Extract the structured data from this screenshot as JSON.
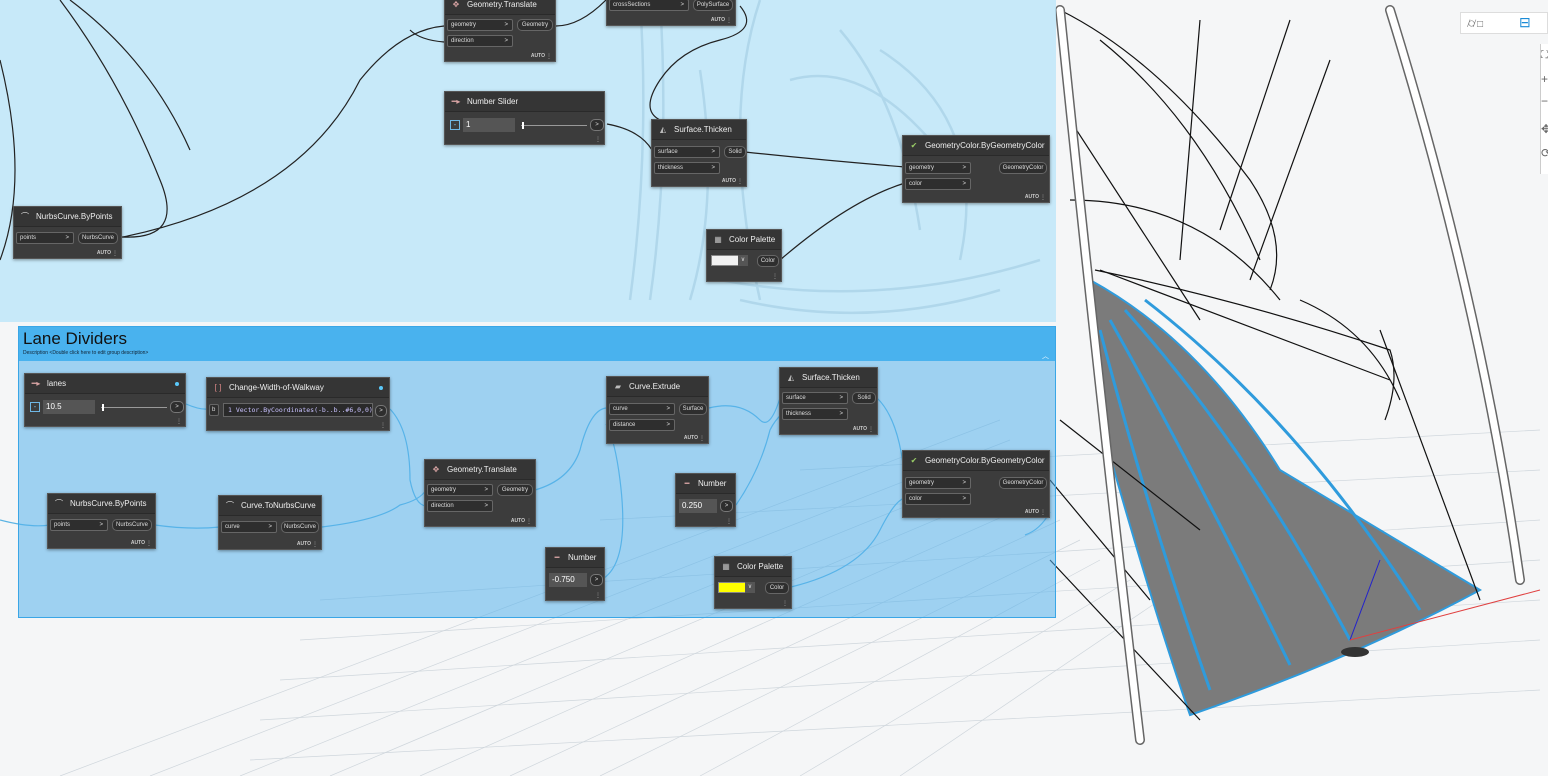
{
  "colors": {
    "group_top": "#bfe6fb",
    "group_lane": "#55b2ec",
    "node_bg": "#3c3c3c",
    "road": "#7a7a7a",
    "lane_line": "#2f9bdc",
    "swatch_yellow": "#ffff00",
    "swatch_white": "#f2f2f2"
  },
  "top_group": {
    "translate_partial": {
      "title": "Geometry.Translate",
      "in1": "geometry",
      "in2": "direction",
      "out": "Geometry",
      "auto": "AUTO"
    },
    "polysurface_partial": {
      "in": "crossSections",
      "out": "PolySurface",
      "auto": "AUTO"
    },
    "slider": {
      "title": "Number Slider",
      "value": "1"
    },
    "thicken": {
      "title": "Surface.Thicken",
      "in1": "surface",
      "in2": "thickness",
      "out": "Solid",
      "auto": "AUTO"
    },
    "geomcolor": {
      "title": "GeometryColor.ByGeometryColor",
      "in1": "geometry",
      "in2": "color",
      "out": "GeometryColor",
      "auto": "AUTO"
    },
    "nurbs": {
      "title": "NurbsCurve.ByPoints",
      "in": "points",
      "out": "NurbsCurve",
      "auto": "AUTO"
    },
    "palette": {
      "title": "Color Palette",
      "out": "Color",
      "swatch": "#f2f2f2"
    }
  },
  "lane_group": {
    "title": "Lane Dividers",
    "description": "Description <Double click here to edit group description>",
    "lanes": {
      "title": "lanes",
      "value": "10.5"
    },
    "cbn": {
      "title": "Change-Width-of-Walkway",
      "in": "b",
      "code": "1  Vector.ByCoordinates(-b..b..#6,0,0);"
    },
    "extrude": {
      "title": "Curve.Extrude",
      "in1": "curve",
      "in2": "distance",
      "out": "Surface",
      "auto": "AUTO"
    },
    "thicken": {
      "title": "Surface.Thicken",
      "in1": "surface",
      "in2": "thickness",
      "out": "Solid",
      "auto": "AUTO"
    },
    "translate": {
      "title": "Geometry.Translate",
      "in1": "geometry",
      "in2": "direction",
      "out": "Geometry",
      "auto": "AUTO"
    },
    "nurbs": {
      "title": "NurbsCurve.ByPoints",
      "in": "points",
      "out": "NurbsCurve",
      "auto": "AUTO"
    },
    "tonurbs": {
      "title": "Curve.ToNurbsCurve",
      "in": "curve",
      "out": "NurbsCurve",
      "auto": "AUTO"
    },
    "number1": {
      "title": "Number",
      "value": "0.250"
    },
    "number2": {
      "title": "Number",
      "value": "-0.750"
    },
    "geomcolor": {
      "title": "GeometryColor.ByGeometryColor",
      "in1": "geometry",
      "in2": "color",
      "out": "GeometryColor",
      "auto": "AUTO"
    },
    "palette": {
      "title": "Color Palette",
      "out": "Color",
      "swatch": "#ffff00"
    }
  },
  "toolbar": {
    "view_3d_icon": "3d-view-icon",
    "graph_icon": "graph-view-icon"
  }
}
